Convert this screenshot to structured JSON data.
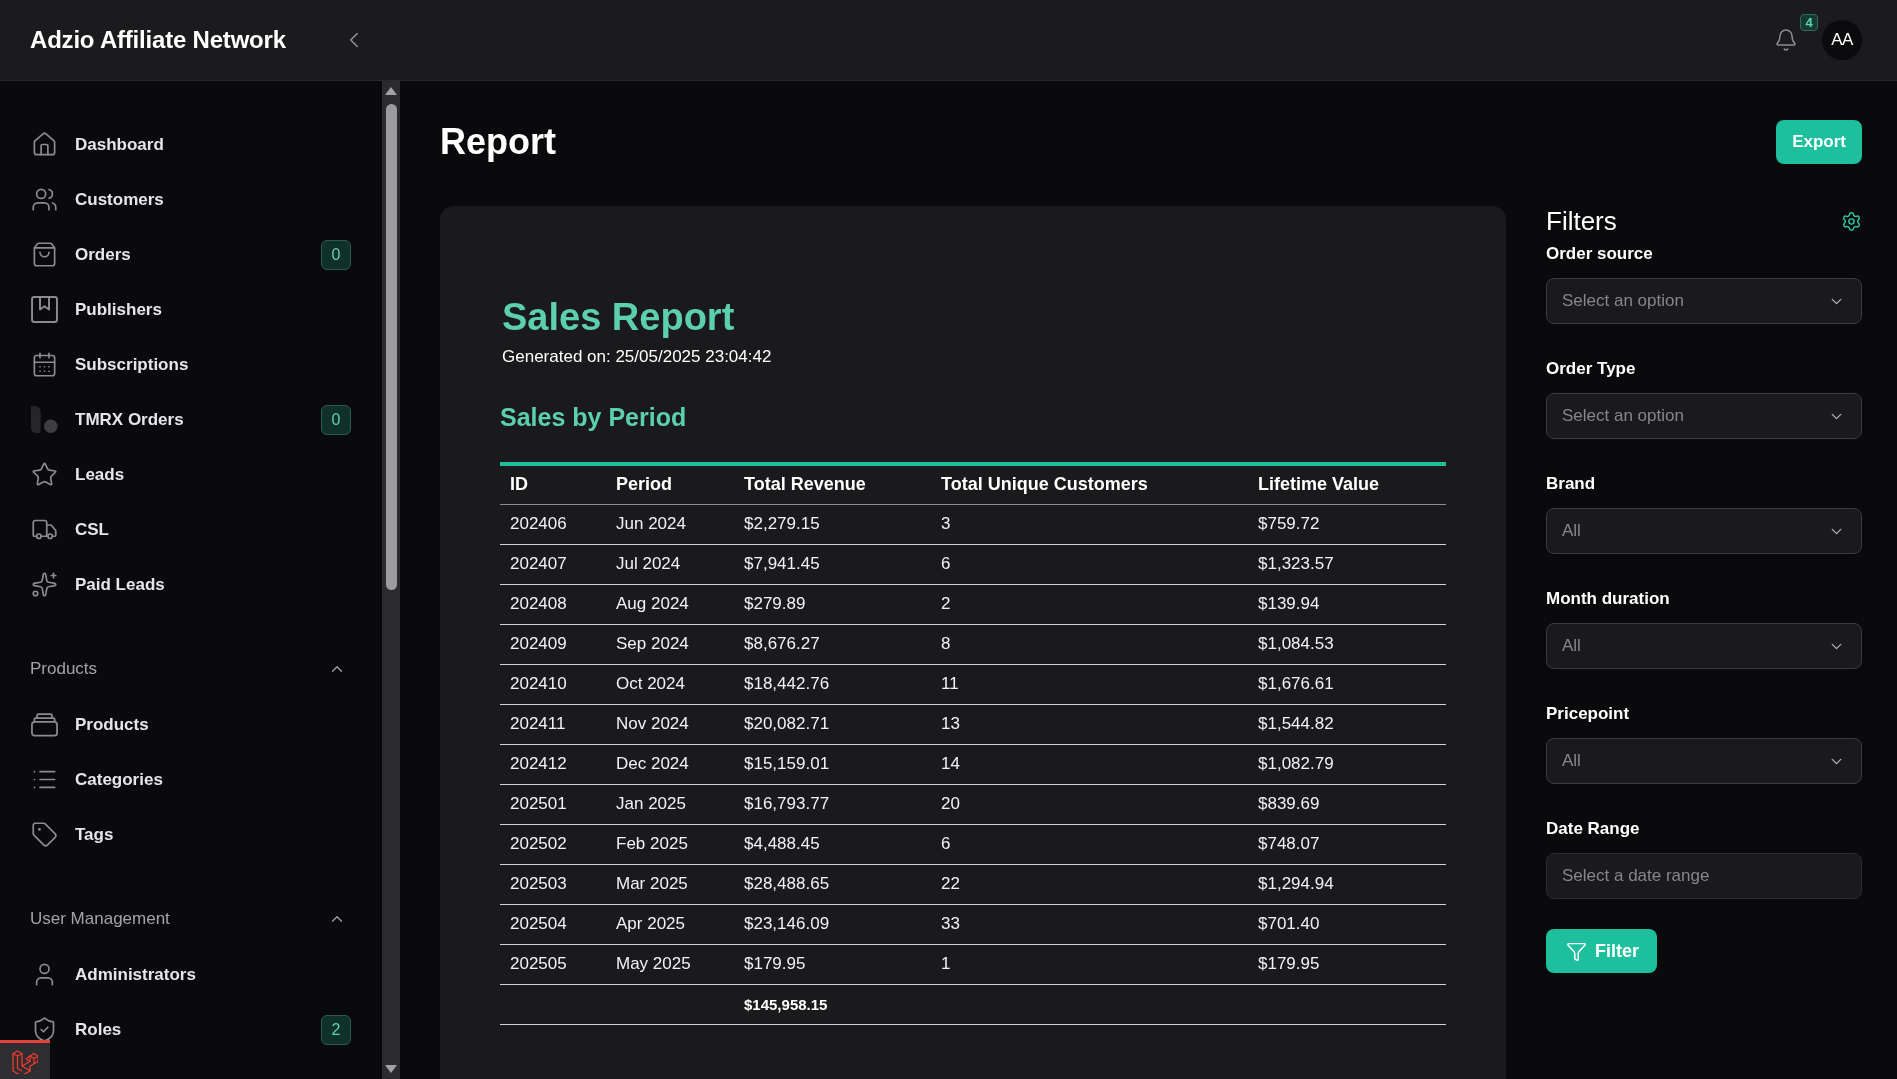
{
  "app": {
    "title": "Adzio Affiliate Network"
  },
  "header": {
    "notification_count": "4",
    "avatar_initials": "AA"
  },
  "sidebar": {
    "items": [
      {
        "label": "Dashboard",
        "selected": false
      },
      {
        "label": "Customers",
        "selected": false
      },
      {
        "label": "Orders",
        "badge": "0",
        "selected": false
      },
      {
        "label": "Publishers",
        "selected": false
      },
      {
        "label": "Subscriptions",
        "selected": false
      },
      {
        "label": "TMRX Orders",
        "badge": "0",
        "selected": false
      },
      {
        "label": "Leads",
        "selected": false
      },
      {
        "label": "CSL",
        "selected": false
      },
      {
        "label": "Paid Leads",
        "selected": false
      }
    ],
    "groups": [
      {
        "label": "Products",
        "expanded": true,
        "items": [
          {
            "label": "Products",
            "selected": false
          },
          {
            "label": "Categories",
            "selected": false
          },
          {
            "label": "Tags",
            "selected": false
          }
        ]
      },
      {
        "label": "User Management",
        "expanded": true,
        "items": [
          {
            "label": "Administrators",
            "selected": false
          },
          {
            "label": "Roles",
            "badge": "2",
            "selected": false
          }
        ]
      }
    ]
  },
  "page": {
    "title": "Report",
    "export_button": "Export"
  },
  "report": {
    "title": "Sales Report",
    "generated": "Generated on: 25/05/2025 23:04:42",
    "section_title": "Sales by Period",
    "table": {
      "columns": [
        "ID",
        "Period",
        "Total Revenue",
        "Total Unique Customers",
        "Lifetime Value"
      ],
      "rows": [
        [
          "202406",
          "Jun 2024",
          "$2,279.15",
          "3",
          "$759.72"
        ],
        [
          "202407",
          "Jul 2024",
          "$7,941.45",
          "6",
          "$1,323.57"
        ],
        [
          "202408",
          "Aug 2024",
          "$279.89",
          "2",
          "$139.94"
        ],
        [
          "202409",
          "Sep 2024",
          "$8,676.27",
          "8",
          "$1,084.53"
        ],
        [
          "202410",
          "Oct 2024",
          "$18,442.76",
          "11",
          "$1,676.61"
        ],
        [
          "202411",
          "Nov 2024",
          "$20,082.71",
          "13",
          "$1,544.82"
        ],
        [
          "202412",
          "Dec 2024",
          "$15,159.01",
          "14",
          "$1,082.79"
        ],
        [
          "202501",
          "Jan 2025",
          "$16,793.77",
          "20",
          "$839.69"
        ],
        [
          "202502",
          "Feb 2025",
          "$4,488.45",
          "6",
          "$748.07"
        ],
        [
          "202503",
          "Mar 2025",
          "$28,488.65",
          "22",
          "$1,294.94"
        ],
        [
          "202504",
          "Apr 2025",
          "$23,146.09",
          "33",
          "$701.40"
        ],
        [
          "202505",
          "May 2025",
          "$179.95",
          "1",
          "$179.95"
        ]
      ],
      "total_revenue": "$145,958.15"
    }
  },
  "filters": {
    "title": "Filters",
    "fields": [
      {
        "label": "Order source",
        "kind": "select",
        "placeholder": "Select an option"
      },
      {
        "label": "Order Type",
        "kind": "select",
        "placeholder": "Select an option"
      },
      {
        "label": "Brand",
        "kind": "select",
        "placeholder": "All"
      },
      {
        "label": "Month duration",
        "kind": "select",
        "placeholder": "All"
      },
      {
        "label": "Pricepoint",
        "kind": "select",
        "placeholder": "All"
      },
      {
        "label": "Date Range",
        "kind": "date",
        "placeholder": "Select a date range"
      }
    ],
    "button": "Filter"
  }
}
